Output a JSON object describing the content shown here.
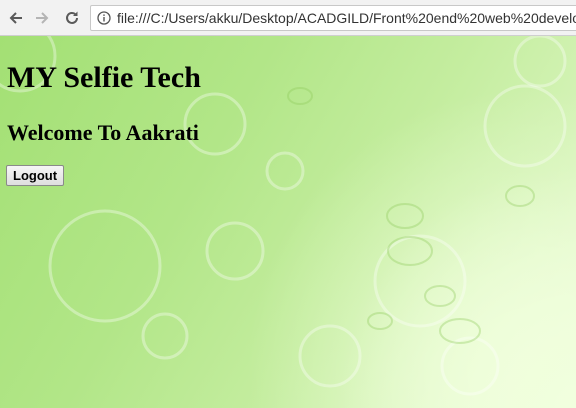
{
  "browser": {
    "url": "file:///C:/Users/akku/Desktop/ACADGILD/Front%20end%20web%20develo"
  },
  "page": {
    "site_title": "MY Selfie Tech",
    "welcome_text": "Welcome To Aakrati",
    "logout_label": "Logout"
  },
  "colors": {
    "background_green": "#b2e688",
    "background_light": "#e6f9d0"
  }
}
